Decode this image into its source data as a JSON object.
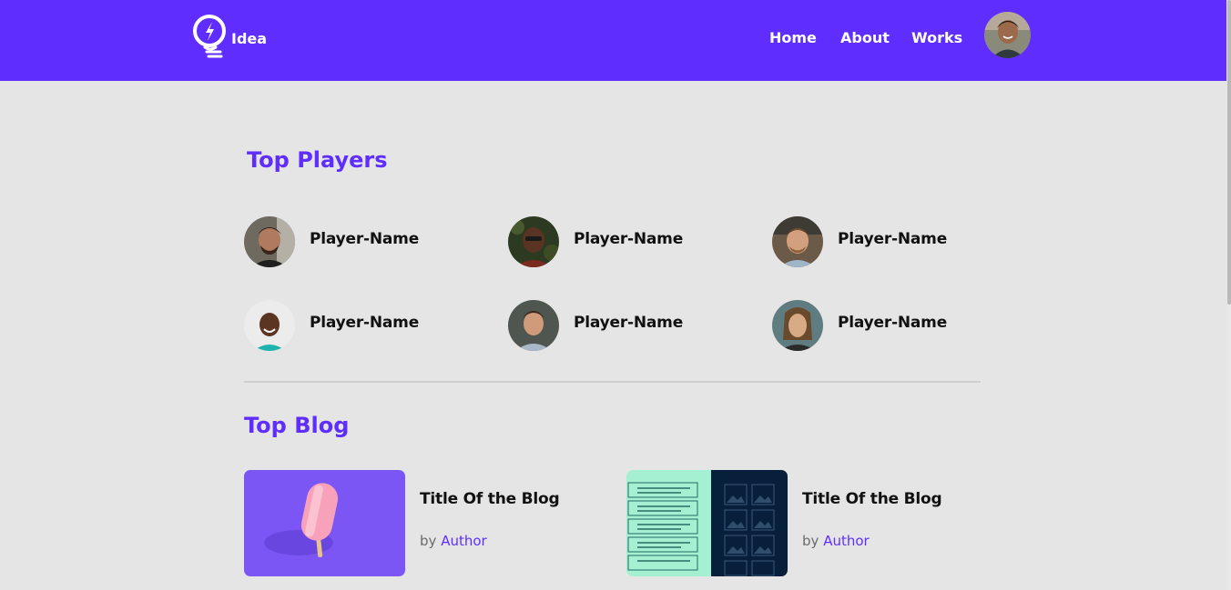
{
  "brand": {
    "name": "Idea",
    "accent": "#5f2eff"
  },
  "nav": {
    "items": [
      "Home",
      "About",
      "Works"
    ]
  },
  "header_avatar": {
    "icon": "user-avatar"
  },
  "top_players": {
    "title": "Top Players",
    "players": [
      {
        "name": "Player-Name",
        "avatar": "player-avatar-1"
      },
      {
        "name": "Player-Name",
        "avatar": "player-avatar-2"
      },
      {
        "name": "Player-Name",
        "avatar": "player-avatar-3"
      },
      {
        "name": "Player-Name",
        "avatar": "player-avatar-4"
      },
      {
        "name": "Player-Name",
        "avatar": "player-avatar-5"
      },
      {
        "name": "Player-Name",
        "avatar": "player-avatar-6"
      }
    ]
  },
  "top_blog": {
    "title": "Top Blog",
    "posts": [
      {
        "title": "Title Of the Blog",
        "by": "by",
        "author": "Author",
        "thumb": "popsicle-illustration"
      },
      {
        "title": "Title Of the Blog",
        "by": "by",
        "author": "Author",
        "thumb": "layout-wireframe-illustration"
      }
    ]
  }
}
